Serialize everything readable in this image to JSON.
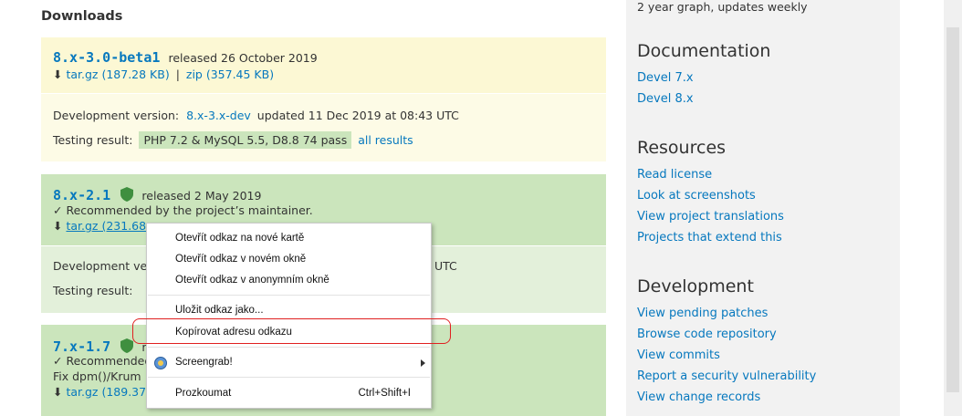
{
  "downloads": {
    "title": "Downloads",
    "releases": [
      {
        "version": "8.x-3.0-beta1",
        "released": "released 26 October 2019",
        "files": [
          {
            "label": "tar.gz (187.28 KB)"
          },
          {
            "label": "zip (357.45 KB)"
          }
        ],
        "separator": "|",
        "dev_label": "Development version:",
        "dev_version": "8.x-3.x-dev",
        "dev_updated": "updated 11 Dec 2019 at 08:43 UTC",
        "testing_label": "Testing result:",
        "testing_result": "PHP 7.2 & MySQL 5.5, D8.8 74 pass",
        "all_results": "all results"
      },
      {
        "version": "8.x-2.1",
        "released": "released 2 May 2019",
        "recommended": "✓ Recommended by the project’s maintainer.",
        "file_visible": "tar.gz (231.68",
        "dev_label": "Development ve",
        "dev_tail": "UTC",
        "testing_label": "Testing result:"
      },
      {
        "version": "7.x-1.7",
        "released_partial": "re",
        "recommended": "✓ Recommended",
        "note": "Fix dpm()/Krum",
        "file_visible": "tar.gz (189.37"
      }
    ]
  },
  "sidebar": {
    "note": "2 year graph, updates weekly",
    "sections": [
      {
        "title": "Documentation",
        "links": [
          "Devel 7.x",
          "Devel 8.x"
        ]
      },
      {
        "title": "Resources",
        "links": [
          "Read license",
          "Look at screenshots",
          "View project translations",
          "Projects that extend this"
        ]
      },
      {
        "title": "Development",
        "links": [
          "View pending patches",
          "Browse code repository",
          "View commits",
          "Report a security vulnerability",
          "View change records"
        ]
      }
    ]
  },
  "context_menu": {
    "items": [
      "Otevřít odkaz na nové kartě",
      "Otevřít odkaz v novém okně",
      "Otevřít odkaz v anonymním okně",
      "Uložit odkaz jako...",
      "Kopírovat adresu odkazu",
      "Screengrab!",
      "Prozkoumat"
    ],
    "inspect_shortcut": "Ctrl+Shift+I",
    "screengrab_icon": "screengrab-icon",
    "highlighted_item": "Kopírovat adresu odkazu",
    "highlight_color": "#e02020"
  },
  "colors": {
    "link": "#0678be",
    "yellow_release": "#fcf8d4",
    "green_release": "#cbe5bc",
    "sidebar_bg": "#f2f2f2"
  }
}
